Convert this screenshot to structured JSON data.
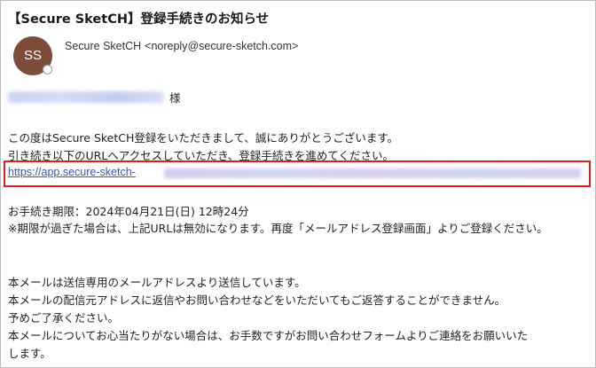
{
  "email": {
    "subject": "【Secure SketCH】登録手続きのお知らせ",
    "avatar_initials": "SS",
    "sender_name": "Secure SketCH",
    "sender_address": "<noreply@secure-sketch.com>",
    "recipient_honorific": "様",
    "body": {
      "line1": "この度はSecure SketCH登録をいただきまして、誠にありがとうございます。",
      "line2": "引き続き以下のURLへアクセスしていただき、登録手続きを進めてください。",
      "link_text": "https://app.secure-sketch-",
      "deadline": "お手続き期限：2024年04月21日(日) 12時24分",
      "deadline_note": "※期限が過ぎた場合は、上記URLは無効になります。再度「メールアドレス登録画面」よりご登録ください。",
      "footer1": "本メールは送信専用のメールアドレスより送信しています。",
      "footer2": "本メールの配信元アドレスに返信やお問い合わせなどをいただいてもご返答することができません。",
      "footer3": "予めご了承ください。",
      "footer4": "本メールについてお心当たりがない場合は、お手数ですがお問い合わせフォームよりご連絡をお願いいた",
      "footer5": "します。"
    }
  },
  "colors": {
    "avatar_bg": "#7d4c3a",
    "link": "#3a55c9",
    "highlight_border": "#e21b1b"
  }
}
